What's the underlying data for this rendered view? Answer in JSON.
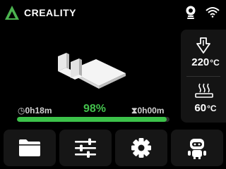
{
  "header": {
    "brand": "CREALITY",
    "logo_icon": "creality-logo-icon",
    "camera_icon": "camera-icon",
    "wifi_icon": "wifi-icon"
  },
  "temperatures": {
    "nozzle": {
      "value": "220",
      "unit": "°C",
      "icon": "nozzle-temperature-icon"
    },
    "bed": {
      "value": "60",
      "unit": "°C",
      "icon": "heated-bed-icon"
    }
  },
  "progress": {
    "elapsed": "0h18m",
    "percent_label": "98%",
    "percent": 98,
    "remaining": "0h00m"
  },
  "toolbar": {
    "files_icon": "folder-icon",
    "adjust_icon": "sliders-icon",
    "settings_icon": "gear-icon",
    "assistant_icon": "robot-icon"
  },
  "colors": {
    "accent_green": "#3cc24a",
    "panel_bg": "#161616"
  }
}
